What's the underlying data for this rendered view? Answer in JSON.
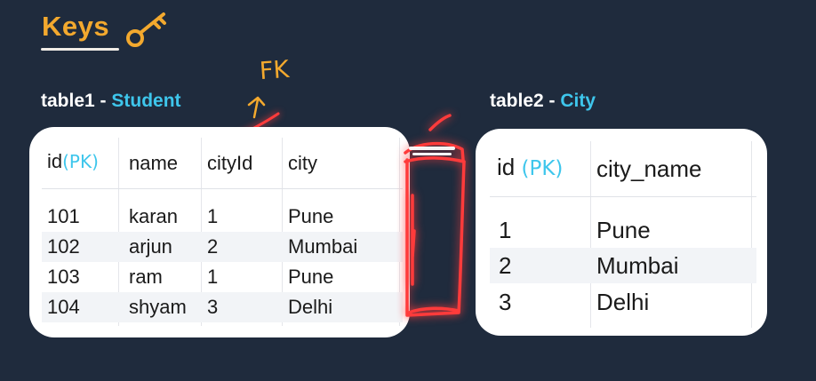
{
  "title": "Keys",
  "table1": {
    "label": "table1",
    "separator": "-",
    "name": "Student",
    "columns": [
      {
        "text": "id",
        "note": "(PK)"
      },
      {
        "text": "name"
      },
      {
        "text": "cityId"
      },
      {
        "text": "city"
      }
    ],
    "rows": [
      [
        "101",
        "karan",
        "1",
        "Pune"
      ],
      [
        "102",
        "arjun",
        "2",
        "Mumbai"
      ],
      [
        "103",
        "ram",
        "1",
        "Pune"
      ],
      [
        "104",
        "shyam",
        "3",
        "Delhi"
      ]
    ]
  },
  "table2": {
    "label": "table2",
    "separator": "-",
    "name": "City",
    "columns": [
      {
        "text": "id",
        "note": "(PK)"
      },
      {
        "text": "city_name"
      }
    ],
    "rows": [
      [
        "1",
        "Pune"
      ],
      [
        "2",
        "Mumbai"
      ],
      [
        "3",
        "Delhi"
      ]
    ]
  },
  "annotations": {
    "fk_label": "FK",
    "fk_color": "#f3a92e",
    "highlight_color": "#ff3b3b",
    "pk_color": "#3ec6ec"
  }
}
